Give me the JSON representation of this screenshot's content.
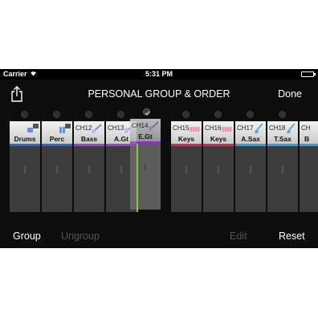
{
  "status_bar": {
    "carrier": "Carrier",
    "time": "5:31 PM"
  },
  "nav": {
    "title": "PERSONAL GROUP & ORDER",
    "done_label": "Done"
  },
  "channels": [
    {
      "num": "",
      "name": "Drums",
      "icon": "drums-icon",
      "color": "#2d63d8"
    },
    {
      "num": "",
      "name": "Perc",
      "icon": "percussion-icon",
      "color": "#2d63d8"
    },
    {
      "num": "CH12",
      "name": "Bass",
      "icon": "bass-guitar-icon",
      "color": "#9b3fd0"
    },
    {
      "num": "CH13",
      "name": "A.Gt",
      "icon": "acoustic-guitar-icon",
      "color": "#9b3fd0"
    },
    {
      "num": "CH14",
      "name": "E.Gt",
      "icon": "electric-guitar-icon",
      "color": "#9b3fd0"
    },
    {
      "num": "CH15",
      "name": "Keys",
      "icon": "keyboard-icon",
      "color": "#e0206a"
    },
    {
      "num": "CH16",
      "name": "Keys",
      "icon": "keyboard-icon",
      "color": "#e0206a"
    },
    {
      "num": "CH17",
      "name": "A.Sax",
      "icon": "saxophone-icon",
      "color": "#1fa3e0"
    },
    {
      "num": "CH18",
      "name": "T.Sax",
      "icon": "saxophone-icon",
      "color": "#1fa3e0"
    },
    {
      "num": "CH",
      "name": "B",
      "icon": "saxophone-icon",
      "color": "#1fa3e0"
    }
  ],
  "toolbar": {
    "group_label": "Group",
    "ungroup_label": "Ungroup",
    "edit_label": "Edit",
    "reset_label": "Reset"
  },
  "colors": {
    "enabled_text": "#ffffff",
    "disabled_text": "#555555",
    "drop_indicator": "#8dc63f"
  }
}
